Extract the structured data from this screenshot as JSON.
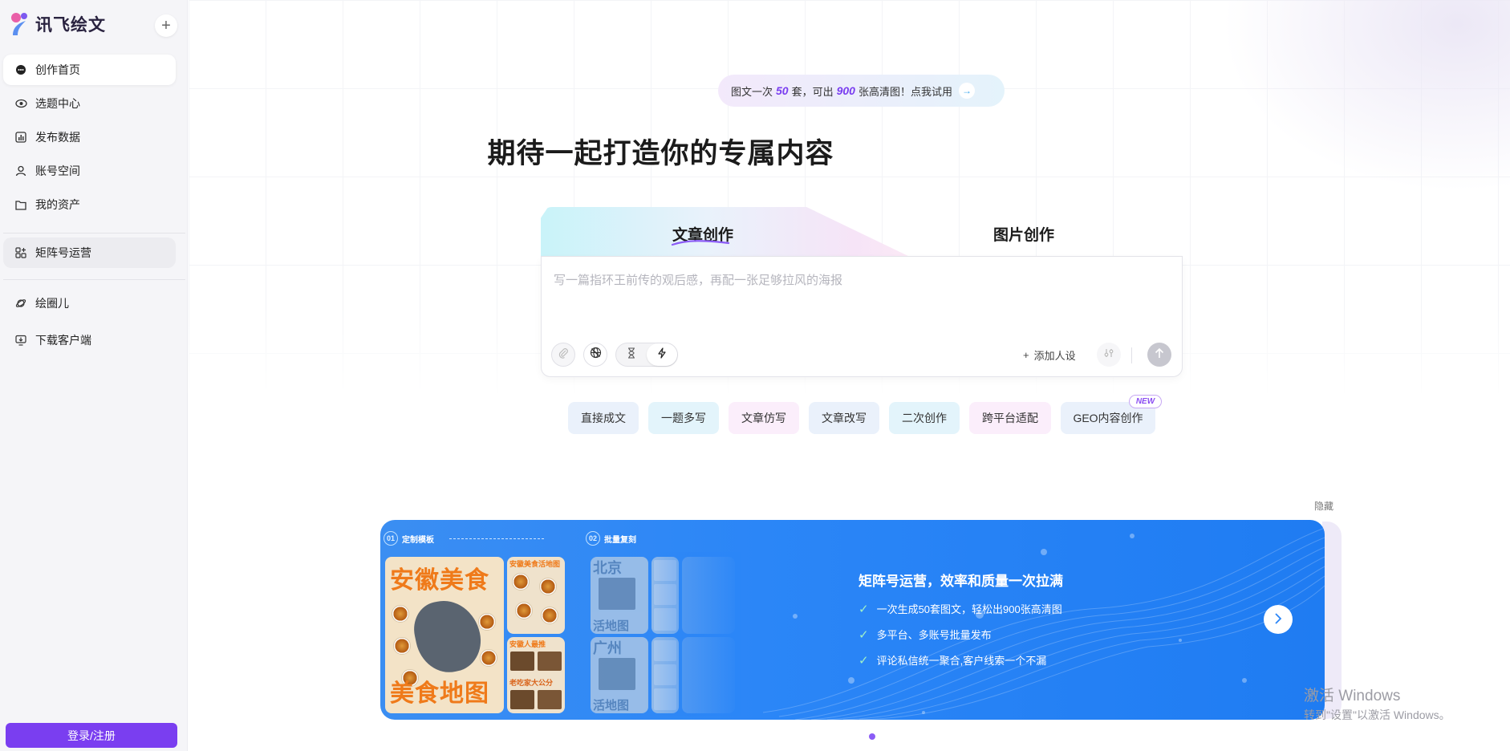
{
  "app": {
    "name": "讯飞绘文"
  },
  "sidebar": {
    "items": [
      {
        "label": "创作首页",
        "icon": "chat-bubble-icon"
      },
      {
        "label": "选题中心",
        "icon": "eye-icon"
      },
      {
        "label": "发布数据",
        "icon": "bar-chart-icon"
      },
      {
        "label": "账号空间",
        "icon": "user-icon"
      },
      {
        "label": "我的资产",
        "icon": "folder-icon"
      },
      {
        "label": "矩阵号运营",
        "icon": "grid-plus-icon"
      },
      {
        "label": "绘圈儿",
        "icon": "orbit-icon"
      },
      {
        "label": "下载客户端",
        "icon": "download-desktop-icon"
      }
    ],
    "login_label": "登录/注册"
  },
  "promo": {
    "part1": "图文一次",
    "num1": "50",
    "part2": "套，可出",
    "num2": "900",
    "part3": "张高清图！点我试用"
  },
  "headline": "期待一起打造你的专属内容",
  "tabs": [
    {
      "label": "文章创作",
      "active": true
    },
    {
      "label": "图片创作",
      "active": false
    }
  ],
  "editor": {
    "placeholder": "写一篇指环王前传的观后感，再配一张足够拉风的海报",
    "add_persona_label": "添加人设"
  },
  "chips": [
    {
      "label": "直接成文",
      "bg": "#eaf1fb"
    },
    {
      "label": "一题多写",
      "bg": "#e3f4fb"
    },
    {
      "label": "文章仿写",
      "bg": "#fbeefb"
    },
    {
      "label": "文章改写",
      "bg": "#eaf1fb"
    },
    {
      "label": "二次创作",
      "bg": "#e3f4fb"
    },
    {
      "label": "跨平台适配",
      "bg": "#fbeefb"
    },
    {
      "label": "GEO内容创作",
      "bg": "#eaf1fb"
    }
  ],
  "new_badge": "NEW",
  "hide_label": "隐藏",
  "banner": {
    "step1": {
      "num": "01",
      "label": "定制模板"
    },
    "step2": {
      "num": "02",
      "label": "批量复刻"
    },
    "poster_main_top": "安徽美食",
    "poster_main_bottom": "美食地图",
    "poster_sm1": "安徽美食活地图",
    "poster_sm2": "安徽人最推",
    "poster_sm3": "老吃家大公分",
    "poster_b1": "北京",
    "poster_b2": "活地图",
    "poster_b3": "广州",
    "poster_b4": "活地图",
    "title": "矩阵号运营，效率和质量一次拉满",
    "bullets": [
      "一次生成50套图文，轻松出900张高清图",
      "多平台、多账号批量发布",
      "评论私信统一聚合,客户线索一个不漏"
    ]
  },
  "watermark": {
    "line1": "激活 Windows",
    "line2": "转到\"设置\"以激活 Windows。"
  },
  "colors": {
    "accent": "#7a3ef0",
    "banner_blue": "#2b86f7"
  }
}
